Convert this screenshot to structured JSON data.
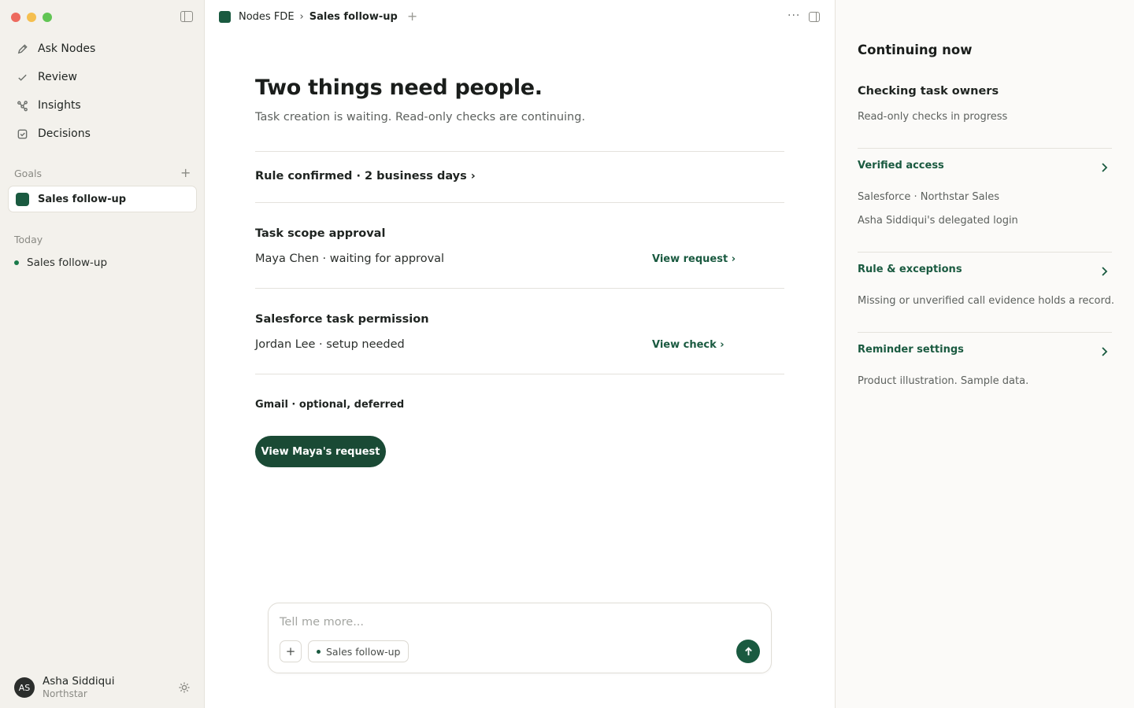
{
  "sidebar": {
    "nav": [
      {
        "label": "Ask Nodes",
        "icon": "pencil-icon"
      },
      {
        "label": "Review",
        "icon": "check-icon"
      },
      {
        "label": "Insights",
        "icon": "graph-nodes-icon"
      },
      {
        "label": "Decisions",
        "icon": "checkbox-icon"
      }
    ],
    "goals_label": "Goals",
    "goal_item": "Sales follow-up",
    "today_label": "Today",
    "today_item": "Sales follow-up",
    "user": {
      "initials": "AS",
      "name": "Asha Siddiqui",
      "org": "Northstar"
    }
  },
  "topbar": {
    "workspace": "Nodes FDE",
    "separator": "›",
    "current": "Sales follow-up",
    "add": "+",
    "more": "···"
  },
  "main": {
    "title": "Two things need people.",
    "subtitle": "Task creation is waiting. Read-only checks are continuing.",
    "rule": "Rule confirmed · 2 business days ›",
    "blocks": [
      {
        "title": "Task scope approval",
        "text": "Maya Chen · waiting for approval",
        "link": "View request ›"
      },
      {
        "title": "Salesforce task permission",
        "text": "Jordan Lee · setup needed",
        "link": "View check ›"
      }
    ],
    "gmail": "Gmail · optional, deferred",
    "primary_button": "View Maya's request"
  },
  "composer": {
    "placeholder": "Tell me more...",
    "add": "+",
    "chip": "Sales follow-up"
  },
  "right_panel": {
    "heading": "Continuing now",
    "status_title": "Checking task owners",
    "status_text": "Read-only checks in progress",
    "sections": [
      {
        "link": "Verified access",
        "lines": [
          "Salesforce · Northstar Sales",
          "Asha Siddiqui's delegated login"
        ]
      },
      {
        "link": "Rule & exceptions",
        "lines": [
          "Missing or unverified call evidence holds a record."
        ]
      },
      {
        "link": "Reminder settings",
        "lines": [
          "Product illustration. Sample data."
        ]
      }
    ]
  },
  "colors": {
    "accent": "#1a5a40",
    "button": "#1a4a35",
    "sidebar_bg": "#f3f1ec",
    "panel_bg": "#fbfaf8"
  }
}
